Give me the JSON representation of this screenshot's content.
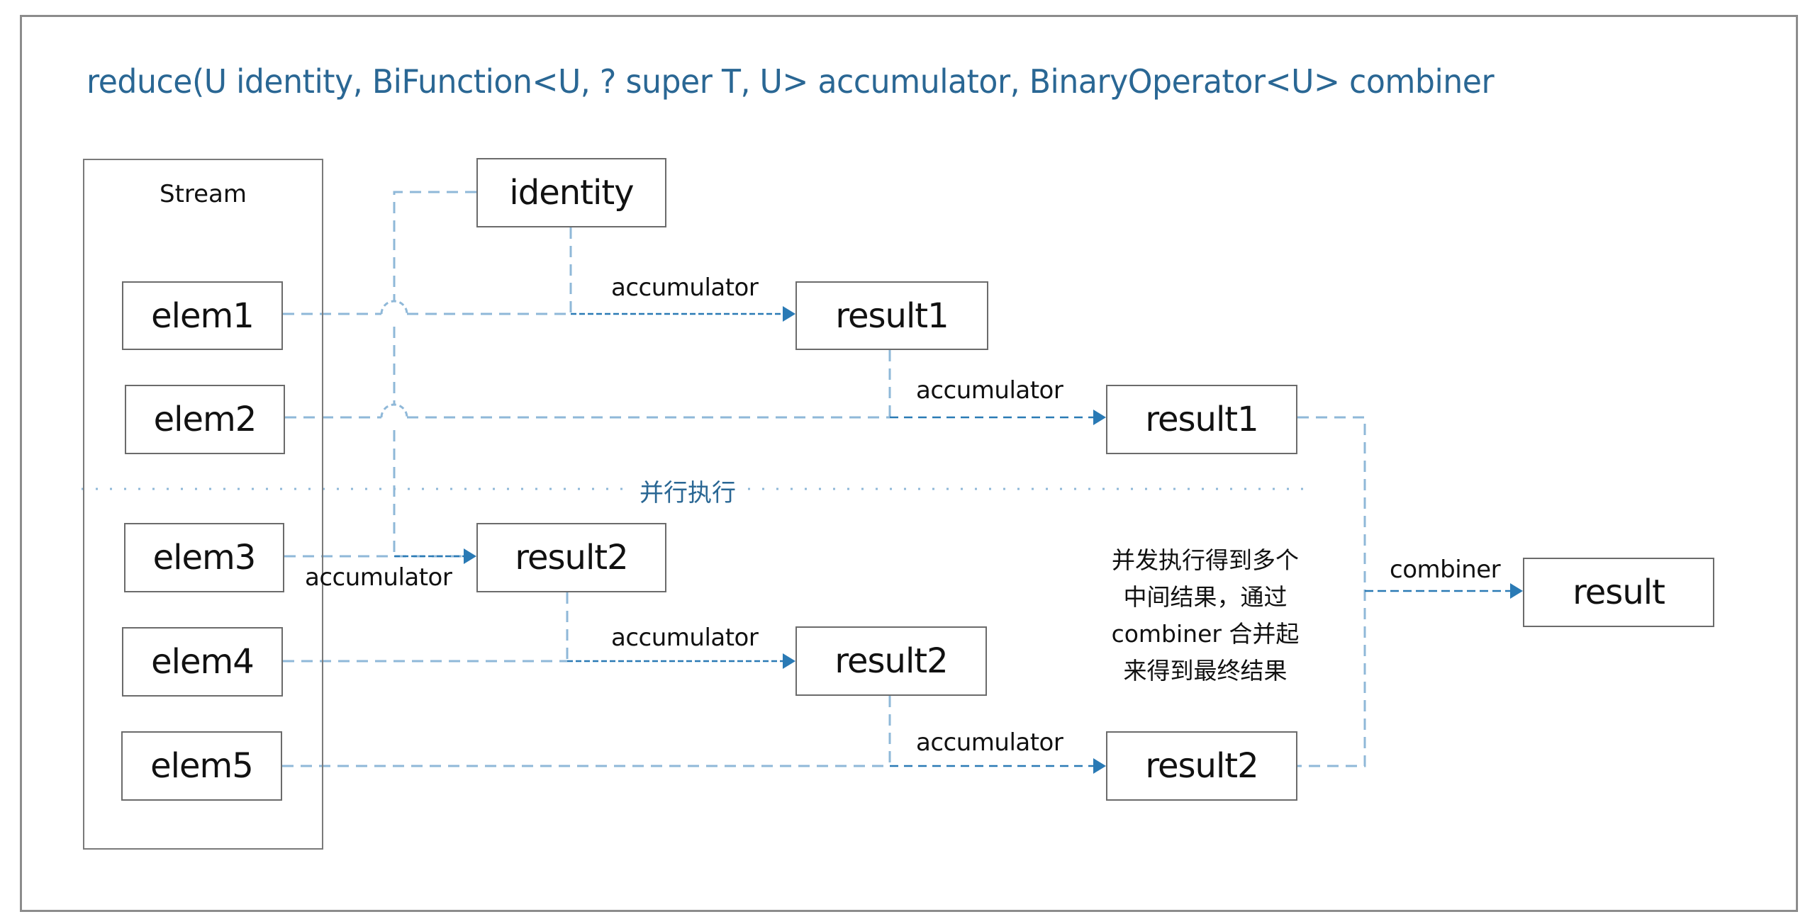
{
  "title": "reduce(U identity, BiFunction<U, ? super T, U> accumulator, BinaryOperator<U> combiner",
  "stream": {
    "label": "Stream",
    "elements": [
      "elem1",
      "elem2",
      "elem3",
      "elem4",
      "elem5"
    ]
  },
  "nodes": {
    "identity": "identity",
    "result1_a": "result1",
    "result1_b": "result1",
    "result2_a": "result2",
    "result2_b": "result2",
    "result2_c": "result2",
    "result": "result"
  },
  "edge_labels": {
    "acc_identity_elem1": "accumulator",
    "acc_result1_elem2": "accumulator",
    "acc_identity_elem3": "accumulator",
    "acc_result2_elem4": "accumulator",
    "acc_result2_elem5": "accumulator",
    "combiner": "combiner"
  },
  "divider_label": "并行执行",
  "note_lines": [
    "并发执行得到多个",
    "中间结果，通过",
    "combiner 合并起",
    "来得到最终结果"
  ],
  "colors": {
    "title": "#2a6794",
    "connector": "#8fb8d8",
    "arrow": "#2a7ab5",
    "box_border": "#6b6b6b"
  }
}
